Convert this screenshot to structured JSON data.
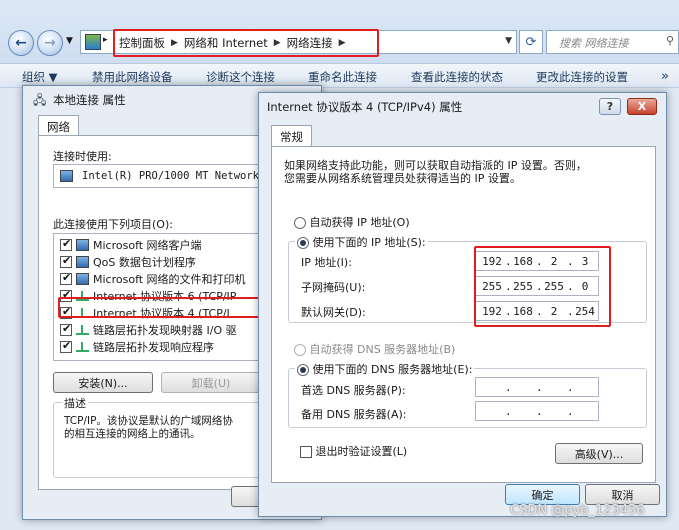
{
  "explorer": {
    "crumbs": [
      "控制面板",
      "网络和 Internet",
      "网络连接"
    ],
    "search_placeholder": "搜索 网络连接",
    "commands": [
      "组织 ▼",
      "禁用此网络设备",
      "诊断这个连接",
      "重命名此连接",
      "查看此连接的状态",
      "更改此连接的设置"
    ]
  },
  "bg_dialog": {
    "title": "本地连接 属性",
    "tab": "网络",
    "connect_using_label": "连接时使用:",
    "adapter": "Intel(R) PRO/1000 MT Network C",
    "items_label": "此连接使用下列项目(O):",
    "items": [
      "Microsoft 网络客户端",
      "QoS 数据包计划程序",
      "Microsoft 网络的文件和打印机",
      "Internet 协议版本 6 (TCP/IP",
      "Internet 协议版本 4 (TCP/I",
      "链路层拓扑发现映射器 I/O 驱",
      "链路层拓扑发现响应程序"
    ],
    "install_button": "安装(N)...",
    "uninstall_button": "卸载(U)",
    "description_label": "描述",
    "description_text": "TCP/IP。该协议是默认的广域网络协\n的相互连接的网络上的通讯。",
    "ok_button_partial": "确"
  },
  "ipv4_dialog": {
    "title": "Internet 协议版本 4 (TCP/IPv4) 属性",
    "help_button": "?",
    "close_button": "X",
    "tab": "常规",
    "intro_line1": "如果网络支持此功能，则可以获取自动指派的 IP 设置。否则，",
    "intro_line2": "您需要从网络系统管理员处获得适当的 IP 设置。",
    "auto_ip_label": "自动获得 IP 地址(O)",
    "manual_ip_label": "使用下面的 IP 地址(S):",
    "ip_label": "IP 地址(I):",
    "mask_label": "子网掩码(U):",
    "gateway_label": "默认网关(D):",
    "ip": [
      "192",
      "168",
      "2",
      "3"
    ],
    "mask": [
      "255",
      "255",
      "255",
      "0"
    ],
    "gateway": [
      "192",
      "168",
      "2",
      "254"
    ],
    "auto_dns_label": "自动获得 DNS 服务器地址(B)",
    "manual_dns_label": "使用下面的 DNS 服务器地址(E):",
    "preferred_dns_label": "首选 DNS 服务器(P):",
    "alternate_dns_label": "备用 DNS 服务器(A):",
    "validate_label": "退出时验证设置(L)",
    "advanced_button": "高级(V)...",
    "ok_button": "确定",
    "cancel_button": "取消"
  },
  "watermark": "CSDN @pyb_123456",
  "colors": {
    "highlight_box": "#e11d1d"
  }
}
